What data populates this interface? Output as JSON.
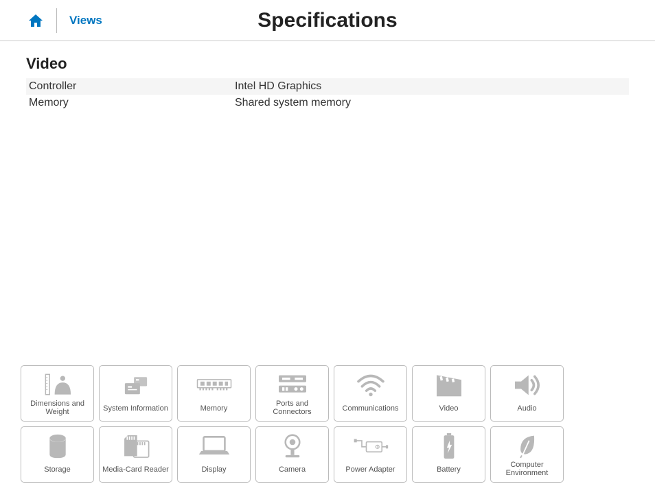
{
  "header": {
    "views_label": "Views",
    "title": "Specifications"
  },
  "section": {
    "title": "Video",
    "rows": [
      {
        "label": "Controller",
        "value": "Intel HD Graphics"
      },
      {
        "label": "Memory",
        "value": "Shared system memory"
      }
    ]
  },
  "nav": [
    {
      "label": "Dimensions and Weight"
    },
    {
      "label": "System Information"
    },
    {
      "label": "Memory"
    },
    {
      "label": "Ports and Connectors"
    },
    {
      "label": "Communications"
    },
    {
      "label": "Video"
    },
    {
      "label": "Audio"
    },
    {
      "label": "Storage"
    },
    {
      "label": "Media-Card Reader"
    },
    {
      "label": "Display"
    },
    {
      "label": "Camera"
    },
    {
      "label": "Power Adapter"
    },
    {
      "label": "Battery"
    },
    {
      "label": "Computer Environment"
    }
  ]
}
